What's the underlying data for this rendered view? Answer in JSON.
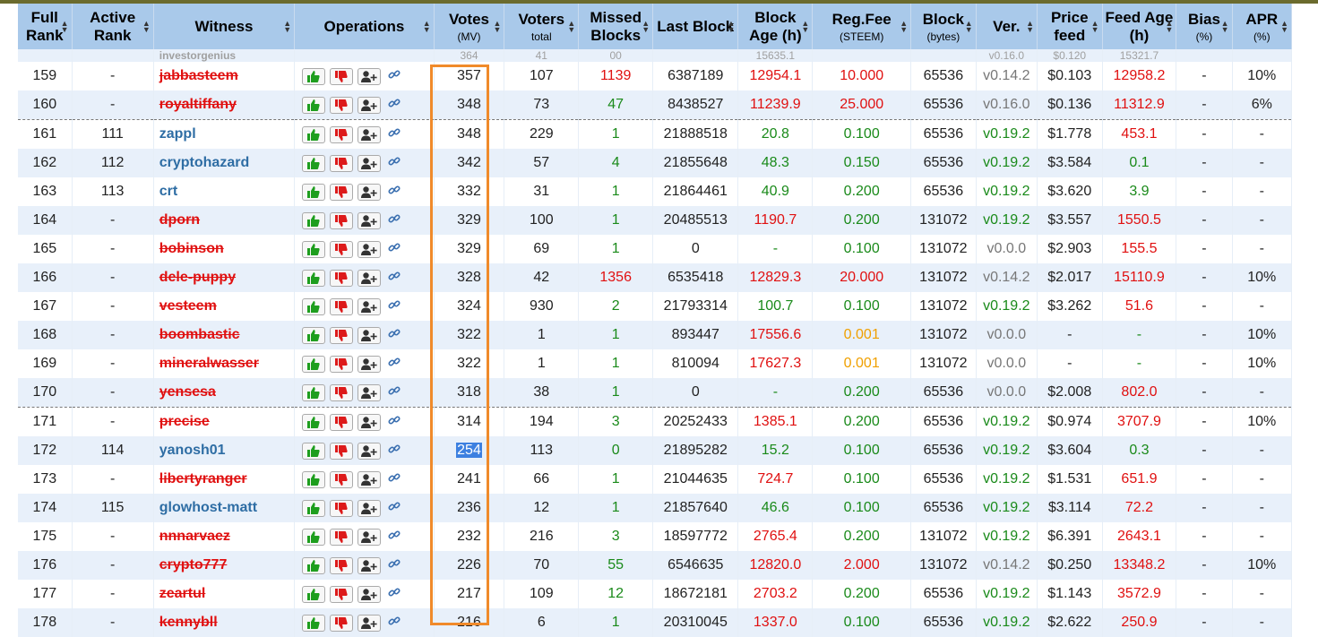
{
  "columns": [
    {
      "label": "Full Rank",
      "sub": ""
    },
    {
      "label": "Active Rank",
      "sub": ""
    },
    {
      "label": "Witness",
      "sub": ""
    },
    {
      "label": "Operations",
      "sub": ""
    },
    {
      "label": "Votes",
      "sub": "(MV)"
    },
    {
      "label": "Voters",
      "sub": "total"
    },
    {
      "label": "Missed Blocks",
      "sub": ""
    },
    {
      "label": "Last Block",
      "sub": ""
    },
    {
      "label": "Block Age (h)",
      "sub": ""
    },
    {
      "label": "Reg.Fee",
      "sub": "(STEEM)"
    },
    {
      "label": "Block",
      "sub": "(bytes)"
    },
    {
      "label": "Ver.",
      "sub": ""
    },
    {
      "label": "Price feed",
      "sub": ""
    },
    {
      "label": "Feed Age (h)",
      "sub": ""
    },
    {
      "label": "Bias",
      "sub": "(%)"
    },
    {
      "label": "APR",
      "sub": "(%)"
    }
  ],
  "partial_row": {
    "witness": "investorgenius",
    "votes": "364",
    "voters": "41",
    "missed": "00",
    "lastblock": "",
    "age": "15635.1",
    "fee": "",
    "block": "",
    "ver": "v0.16.0",
    "price": "$0.120",
    "feed": "15321.7"
  },
  "rows": [
    {
      "full": "159",
      "active": "-",
      "witness": "jabbasteem",
      "status": "disabled",
      "votes": "357",
      "voters": "107",
      "missed": "1139",
      "missed_c": "red",
      "lastblock": "6387189",
      "age": "12954.1",
      "age_c": "red",
      "fee": "10.000",
      "fee_c": "red",
      "block": "65536",
      "ver": "v0.14.2",
      "ver_c": "gray",
      "price": "$0.103",
      "feed": "12958.2",
      "feed_c": "red",
      "bias": "-",
      "apr": "10%"
    },
    {
      "full": "160",
      "active": "-",
      "witness": "royaltiffany",
      "status": "disabled",
      "votes": "348",
      "voters": "73",
      "missed": "47",
      "missed_c": "green",
      "lastblock": "8438527",
      "age": "11239.9",
      "age_c": "red",
      "fee": "25.000",
      "fee_c": "red",
      "block": "65536",
      "ver": "v0.16.0",
      "ver_c": "gray",
      "price": "$0.136",
      "feed": "11312.9",
      "feed_c": "red",
      "bias": "-",
      "apr": "6%"
    },
    {
      "full": "161",
      "active": "111",
      "witness": "zappl",
      "status": "active",
      "votes": "348",
      "voters": "229",
      "missed": "1",
      "missed_c": "green",
      "lastblock": "21888518",
      "age": "20.8",
      "age_c": "green",
      "fee": "0.100",
      "fee_c": "green",
      "block": "65536",
      "ver": "v0.19.2",
      "ver_c": "green",
      "price": "$1.778",
      "feed": "453.1",
      "feed_c": "red",
      "bias": "-",
      "apr": "-",
      "group": true
    },
    {
      "full": "162",
      "active": "112",
      "witness": "cryptohazard",
      "status": "active",
      "votes": "342",
      "voters": "57",
      "missed": "4",
      "missed_c": "green",
      "lastblock": "21855648",
      "age": "48.3",
      "age_c": "green",
      "fee": "0.150",
      "fee_c": "green",
      "block": "65536",
      "ver": "v0.19.2",
      "ver_c": "green",
      "price": "$3.584",
      "feed": "0.1",
      "feed_c": "green",
      "bias": "-",
      "apr": "-"
    },
    {
      "full": "163",
      "active": "113",
      "witness": "crt",
      "status": "active",
      "votes": "332",
      "voters": "31",
      "missed": "1",
      "missed_c": "green",
      "lastblock": "21864461",
      "age": "40.9",
      "age_c": "green",
      "fee": "0.200",
      "fee_c": "green",
      "block": "65536",
      "ver": "v0.19.2",
      "ver_c": "green",
      "price": "$3.620",
      "feed": "3.9",
      "feed_c": "green",
      "bias": "-",
      "apr": "-"
    },
    {
      "full": "164",
      "active": "-",
      "witness": "dporn",
      "status": "disabled",
      "votes": "329",
      "voters": "100",
      "missed": "1",
      "missed_c": "green",
      "lastblock": "20485513",
      "age": "1190.7",
      "age_c": "red",
      "fee": "0.200",
      "fee_c": "green",
      "block": "131072",
      "ver": "v0.19.2",
      "ver_c": "green",
      "price": "$3.557",
      "feed": "1550.5",
      "feed_c": "red",
      "bias": "-",
      "apr": "-"
    },
    {
      "full": "165",
      "active": "-",
      "witness": "bobinson",
      "status": "disabled",
      "votes": "329",
      "voters": "69",
      "missed": "1",
      "missed_c": "green",
      "lastblock": "0",
      "age": "-",
      "age_c": "green",
      "fee": "0.100",
      "fee_c": "green",
      "block": "131072",
      "ver": "v0.0.0",
      "ver_c": "gray",
      "price": "$2.903",
      "feed": "155.5",
      "feed_c": "red",
      "bias": "-",
      "apr": "-"
    },
    {
      "full": "166",
      "active": "-",
      "witness": "dele-puppy",
      "status": "disabled",
      "votes": "328",
      "voters": "42",
      "missed": "1356",
      "missed_c": "red",
      "lastblock": "6535418",
      "age": "12829.3",
      "age_c": "red",
      "fee": "20.000",
      "fee_c": "red",
      "block": "131072",
      "ver": "v0.14.2",
      "ver_c": "gray",
      "price": "$2.017",
      "feed": "15110.9",
      "feed_c": "red",
      "bias": "-",
      "apr": "10%"
    },
    {
      "full": "167",
      "active": "-",
      "witness": "vesteem",
      "status": "disabled",
      "votes": "324",
      "voters": "930",
      "missed": "2",
      "missed_c": "green",
      "lastblock": "21793314",
      "age": "100.7",
      "age_c": "green",
      "fee": "0.100",
      "fee_c": "green",
      "block": "131072",
      "ver": "v0.19.2",
      "ver_c": "green",
      "price": "$3.262",
      "feed": "51.6",
      "feed_c": "red",
      "bias": "-",
      "apr": "-"
    },
    {
      "full": "168",
      "active": "-",
      "witness": "boombastic",
      "status": "disabled",
      "votes": "322",
      "voters": "1",
      "missed": "1",
      "missed_c": "green",
      "lastblock": "893447",
      "age": "17556.6",
      "age_c": "red",
      "fee": "0.001",
      "fee_c": "orange",
      "block": "131072",
      "ver": "v0.0.0",
      "ver_c": "gray",
      "price": "-",
      "feed": "-",
      "feed_c": "green",
      "bias": "-",
      "apr": "10%"
    },
    {
      "full": "169",
      "active": "-",
      "witness": "mineralwasser",
      "status": "disabled",
      "votes": "322",
      "voters": "1",
      "missed": "1",
      "missed_c": "green",
      "lastblock": "810094",
      "age": "17627.3",
      "age_c": "red",
      "fee": "0.001",
      "fee_c": "orange",
      "block": "131072",
      "ver": "v0.0.0",
      "ver_c": "gray",
      "price": "-",
      "feed": "-",
      "feed_c": "green",
      "bias": "-",
      "apr": "10%"
    },
    {
      "full": "170",
      "active": "-",
      "witness": "yensesa",
      "status": "disabled",
      "votes": "318",
      "voters": "38",
      "missed": "1",
      "missed_c": "green",
      "lastblock": "0",
      "age": "-",
      "age_c": "green",
      "fee": "0.200",
      "fee_c": "green",
      "block": "65536",
      "ver": "v0.0.0",
      "ver_c": "gray",
      "price": "$2.008",
      "feed": "802.0",
      "feed_c": "red",
      "bias": "-",
      "apr": "-"
    },
    {
      "full": "171",
      "active": "-",
      "witness": "precise",
      "status": "disabled",
      "votes": "314",
      "voters": "194",
      "missed": "3",
      "missed_c": "green",
      "lastblock": "20252433",
      "age": "1385.1",
      "age_c": "red",
      "fee": "0.200",
      "fee_c": "green",
      "block": "65536",
      "ver": "v0.19.2",
      "ver_c": "green",
      "price": "$0.974",
      "feed": "3707.9",
      "feed_c": "red",
      "bias": "-",
      "apr": "10%",
      "group": true
    },
    {
      "full": "172",
      "active": "114",
      "witness": "yanosh01",
      "status": "active",
      "votes": "254",
      "voters": "113",
      "missed": "0",
      "missed_c": "green",
      "lastblock": "21895282",
      "age": "15.2",
      "age_c": "green",
      "fee": "0.100",
      "fee_c": "green",
      "block": "65536",
      "ver": "v0.19.2",
      "ver_c": "green",
      "price": "$3.604",
      "feed": "0.3",
      "feed_c": "green",
      "bias": "-",
      "apr": "-",
      "selected": true
    },
    {
      "full": "173",
      "active": "-",
      "witness": "libertyranger",
      "status": "disabled",
      "votes": "241",
      "voters": "66",
      "missed": "1",
      "missed_c": "green",
      "lastblock": "21044635",
      "age": "724.7",
      "age_c": "red",
      "fee": "0.100",
      "fee_c": "green",
      "block": "65536",
      "ver": "v0.19.2",
      "ver_c": "green",
      "price": "$1.531",
      "feed": "651.9",
      "feed_c": "red",
      "bias": "-",
      "apr": "-"
    },
    {
      "full": "174",
      "active": "115",
      "witness": "glowhost-matt",
      "status": "active",
      "votes": "236",
      "voters": "12",
      "missed": "1",
      "missed_c": "green",
      "lastblock": "21857640",
      "age": "46.6",
      "age_c": "green",
      "fee": "0.100",
      "fee_c": "green",
      "block": "65536",
      "ver": "v0.19.2",
      "ver_c": "green",
      "price": "$3.114",
      "feed": "72.2",
      "feed_c": "red",
      "bias": "-",
      "apr": "-"
    },
    {
      "full": "175",
      "active": "-",
      "witness": "nnnarvaez",
      "status": "disabled",
      "votes": "232",
      "voters": "216",
      "missed": "3",
      "missed_c": "green",
      "lastblock": "18597772",
      "age": "2765.4",
      "age_c": "red",
      "fee": "0.200",
      "fee_c": "green",
      "block": "131072",
      "ver": "v0.19.2",
      "ver_c": "green",
      "price": "$6.391",
      "feed": "2643.1",
      "feed_c": "red",
      "bias": "-",
      "apr": "-"
    },
    {
      "full": "176",
      "active": "-",
      "witness": "crypto777",
      "status": "disabled",
      "votes": "226",
      "voters": "70",
      "missed": "55",
      "missed_c": "green",
      "lastblock": "6546635",
      "age": "12820.0",
      "age_c": "red",
      "fee": "2.000",
      "fee_c": "red",
      "block": "131072",
      "ver": "v0.14.2",
      "ver_c": "gray",
      "price": "$0.250",
      "feed": "13348.2",
      "feed_c": "red",
      "bias": "-",
      "apr": "10%"
    },
    {
      "full": "177",
      "active": "-",
      "witness": "zeartul",
      "status": "disabled",
      "votes": "217",
      "voters": "109",
      "missed": "12",
      "missed_c": "green",
      "lastblock": "18672181",
      "age": "2703.2",
      "age_c": "red",
      "fee": "0.200",
      "fee_c": "green",
      "block": "65536",
      "ver": "v0.19.2",
      "ver_c": "green",
      "price": "$1.143",
      "feed": "3572.9",
      "feed_c": "red",
      "bias": "-",
      "apr": "-"
    },
    {
      "full": "178",
      "active": "-",
      "witness": "kennybll",
      "status": "disabled",
      "votes": "216",
      "voters": "6",
      "missed": "1",
      "missed_c": "green",
      "lastblock": "20310045",
      "age": "1337.0",
      "age_c": "red",
      "fee": "0.100",
      "fee_c": "green",
      "block": "65536",
      "ver": "v0.19.2",
      "ver_c": "green",
      "price": "$2.622",
      "feed": "250.9",
      "feed_c": "red",
      "bias": "-",
      "apr": "-"
    }
  ],
  "icons": {
    "upvote": "thumbs-up-icon",
    "downvote": "thumbs-down-icon",
    "proxy": "add-user-icon",
    "link": "link-icon"
  },
  "colors": {
    "header_bg": "#a9c9ea",
    "active_witness": "#2e6da4",
    "disabled_witness": "#e01010",
    "highlight_box": "#f08a2a",
    "selection": "#3d80e0"
  }
}
